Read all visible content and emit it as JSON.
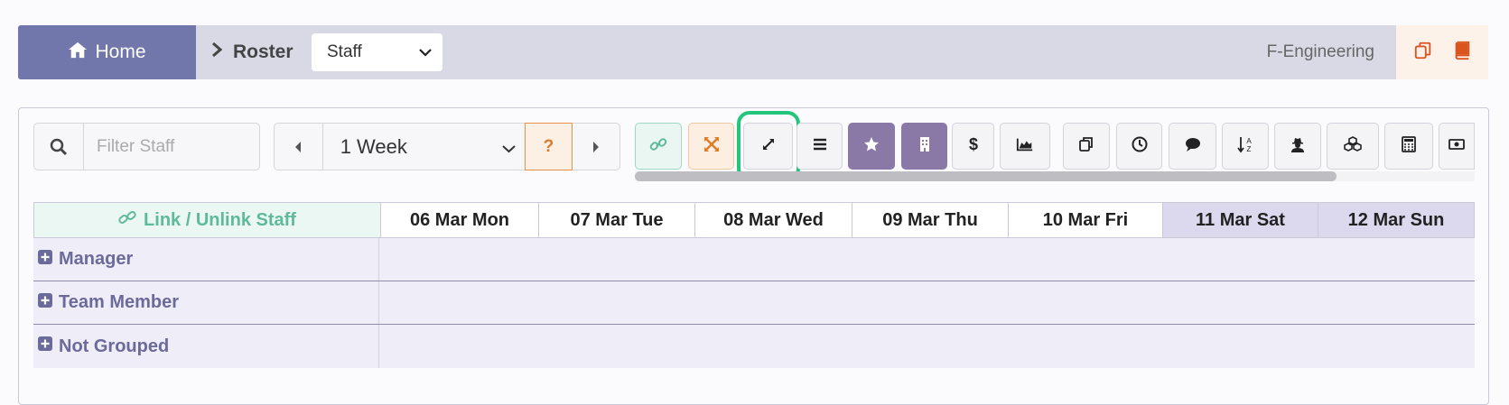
{
  "topbar": {
    "home_label": "Home",
    "breadcrumb": "Roster",
    "view_select": "Staff",
    "department": "F-Engineering",
    "icons": [
      "copy-icon",
      "book-icon"
    ]
  },
  "toolbar": {
    "filter_placeholder": "Filter Staff",
    "period_select": "1 Week",
    "help_label": "?",
    "buttons": [
      "link-icon",
      "shuffle-icon",
      "expand-icon",
      "menu-icon",
      "star-icon",
      "building-icon",
      "dollar-icon",
      "area-chart-icon",
      "copy-icon",
      "clock-icon",
      "comments-icon",
      "sort-alpha-icon",
      "user-secret-icon",
      "cubes-icon",
      "calculator-icon",
      "money-icon"
    ]
  },
  "grid": {
    "link_header": "Link / Unlink Staff",
    "days": [
      {
        "label": "06 Mar Mon",
        "weekend": false
      },
      {
        "label": "07 Mar Tue",
        "weekend": false
      },
      {
        "label": "08 Mar Wed",
        "weekend": false
      },
      {
        "label": "09 Mar Thu",
        "weekend": false
      },
      {
        "label": "10 Mar Fri",
        "weekend": false
      },
      {
        "label": "11 Mar Sat",
        "weekend": true
      },
      {
        "label": "12 Mar Sun",
        "weekend": true
      }
    ],
    "groups": [
      "Manager",
      "Team Member",
      "Not Grouped"
    ]
  },
  "colors": {
    "home": "#7277ab",
    "link_green": "#5fb99a",
    "purple": "#8a78a6",
    "highlight": "#22c57a",
    "group_text": "#6c6a9a"
  }
}
